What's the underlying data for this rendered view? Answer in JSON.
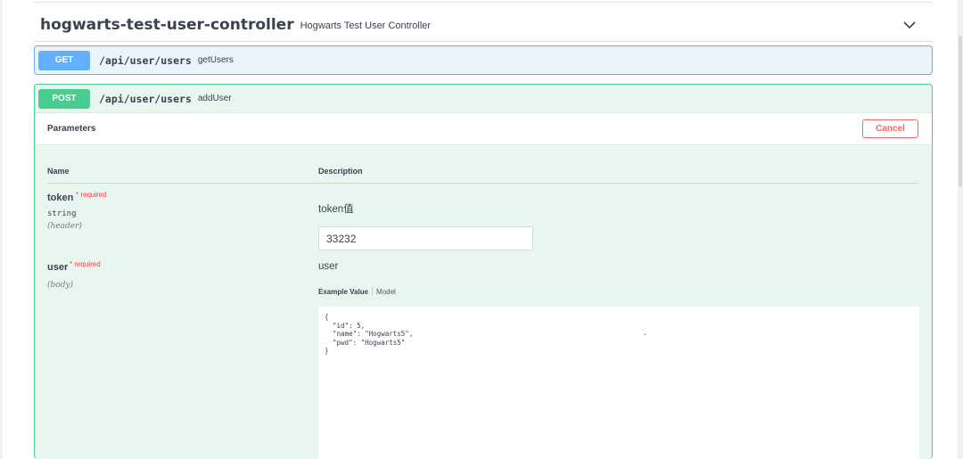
{
  "tag": {
    "name": "hogwarts-test-user-controller",
    "description": "Hogwarts Test User Controller"
  },
  "operations": [
    {
      "method": "GET",
      "path": "/api/user/users",
      "summary": "getUsers",
      "color": "#61affe"
    },
    {
      "method": "POST",
      "path": "/api/user/users",
      "summary": "addUser",
      "color": "#49cc90"
    }
  ],
  "parameters_section": {
    "title": "Parameters",
    "cancel_label": "Cancel",
    "name_header": "Name",
    "description_header": "Description"
  },
  "params": [
    {
      "name": "token",
      "required_label": "* required",
      "type": "string",
      "location": "(header)",
      "description": "token值",
      "value": "33232"
    },
    {
      "name": "user",
      "required_label": "* required",
      "location": "(body)",
      "description": "user",
      "example_tab": "Example Value",
      "model_tab": "Model",
      "example_value": "{\n  \"id\": 5,\n  \"name\": \"Hogwarts5\",\n  \"pwd\": \"Hogwarts5\"\n}"
    }
  ],
  "icons": {
    "collapse": "chevron-down-icon"
  }
}
